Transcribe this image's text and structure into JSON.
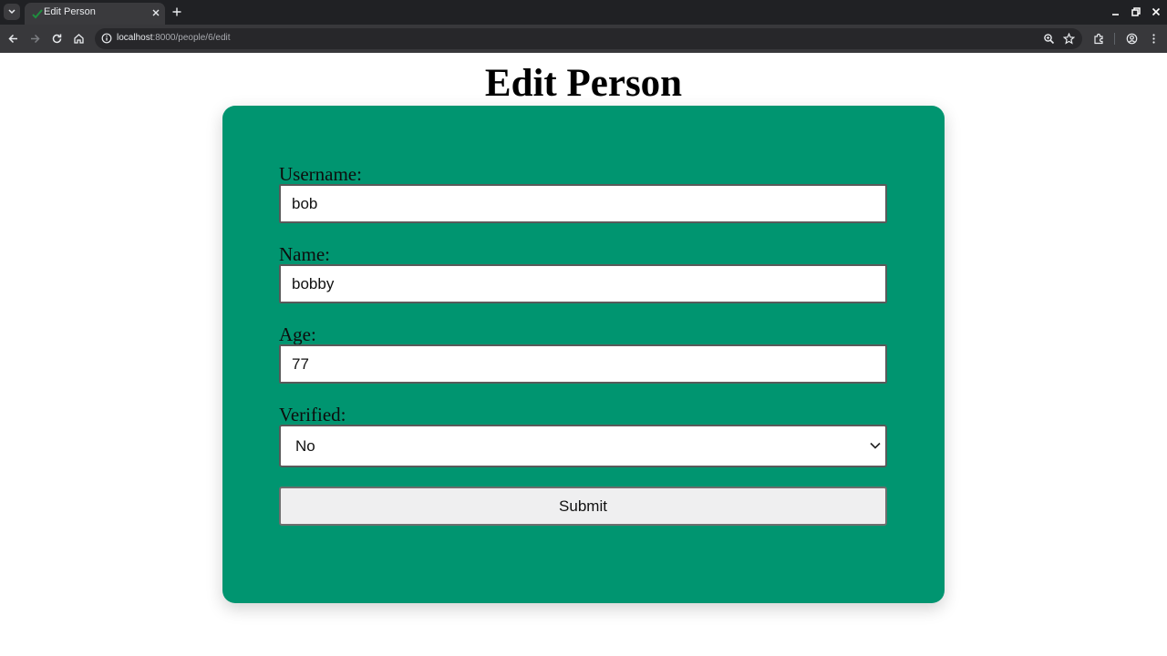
{
  "browser": {
    "tab_title": "Edit Person",
    "url_host": "localhost",
    "url_path": ":8000/people/6/edit"
  },
  "page": {
    "title": "Edit Person"
  },
  "form": {
    "username": {
      "label": "Username:",
      "value": "bob"
    },
    "name": {
      "label": "Name:",
      "value": "bobby"
    },
    "age": {
      "label": "Age:",
      "value": "77"
    },
    "verified": {
      "label": "Verified:",
      "value": "No"
    },
    "submit_label": "Submit"
  },
  "colors": {
    "card_background": "#009570",
    "page_background": "#ffffff",
    "browser_chrome": "#202124"
  },
  "icons": {
    "tabbar": [
      "tab-list-icon",
      "favicon-icon",
      "close-tab-icon",
      "new-tab-icon",
      "minimize-icon",
      "restore-icon",
      "close-window-icon"
    ],
    "toolbar": [
      "back-icon",
      "forward-icon",
      "reload-icon",
      "home-icon",
      "site-info-icon",
      "zoom-icon",
      "bookmark-star-icon",
      "extensions-icon",
      "profile-icon",
      "menu-icon"
    ],
    "form": [
      "chevron-down-icon"
    ]
  }
}
